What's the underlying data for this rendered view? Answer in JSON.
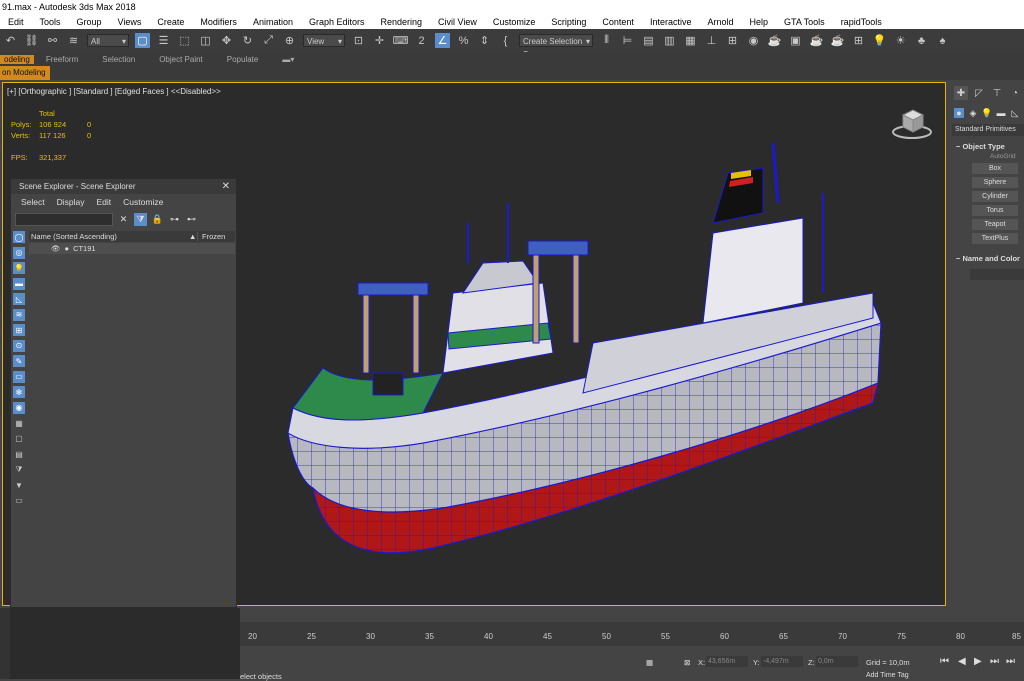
{
  "window": {
    "title": "91.max - Autodesk 3ds Max 2018"
  },
  "menu": [
    "Edit",
    "Tools",
    "Group",
    "Views",
    "Create",
    "Modifiers",
    "Animation",
    "Graph Editors",
    "Rendering",
    "Civil View",
    "Customize",
    "Scripting",
    "Content",
    "Interactive",
    "Arnold",
    "Help",
    "GTA Tools",
    "rapidTools"
  ],
  "toolbar": {
    "filter_value": "All",
    "view_value": "View",
    "selection_set": "Create Selection Se"
  },
  "ribbon": {
    "tabs": [
      "odeling",
      "Freeform",
      "Selection",
      "Object Paint",
      "Populate"
    ],
    "active_sub": "on Modeling"
  },
  "viewport": {
    "label": "[+] [Orthographic ] [Standard ] [Edged Faces ]  <<Disabled>>",
    "stats": {
      "total_label": "Total",
      "polys_label": "Polys:",
      "polys_value": "106 924",
      "polys_sel": "0",
      "verts_label": "Verts:",
      "verts_value": "117 126",
      "verts_sel": "0",
      "fps_label": "FPS:",
      "fps_value": "321,337"
    }
  },
  "scene_explorer": {
    "title": "Scene Explorer - Scene Explorer",
    "menu": [
      "Select",
      "Display",
      "Edit",
      "Customize"
    ],
    "col_name": "Name (Sorted Ascending)",
    "col_frozen": "Frozen",
    "object": "CT191"
  },
  "command_panel": {
    "dropdown": "Standard Primitives",
    "object_type_title": "Object Type",
    "autogrid": "AutoGrid",
    "primitives": [
      "Box",
      "Sphere",
      "Cylinder",
      "Torus",
      "Teapot",
      "TextPlus"
    ],
    "name_color_title": "Name and Color"
  },
  "timeline": {
    "ticks": [
      "20",
      "25",
      "30",
      "35",
      "40",
      "45",
      "50",
      "55",
      "60",
      "65",
      "70",
      "75",
      "80",
      "85"
    ]
  },
  "status": {
    "prompt": "elect objects",
    "x_label": "X:",
    "x_value": "43,656m",
    "y_label": "Y:",
    "y_value": "-4,497m",
    "z_label": "Z:",
    "z_value": "0,0m",
    "grid": "Grid = 10,0m",
    "add_time_tag": "Add Time Tag"
  },
  "colors": {
    "accent_blue": "#5b8dc9",
    "viewport_border": "#e6b400",
    "hull_red": "#b01818",
    "wire_blue": "#1a1ad0"
  }
}
